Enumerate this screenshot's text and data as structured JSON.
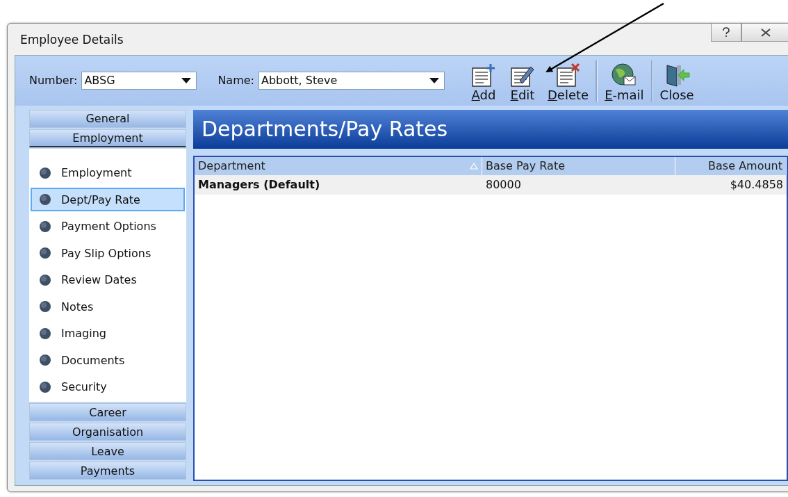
{
  "window": {
    "title": "Employee Details"
  },
  "filters": [
    {
      "label": "Number:",
      "value": "ABSG"
    },
    {
      "label": "Name:",
      "value": "Abbott, Steve"
    }
  ],
  "toolbar": [
    {
      "kind": "add",
      "label": "Add",
      "mnemonic_underlined": true
    },
    {
      "kind": "edit",
      "label": "Edit",
      "mnemonic_underlined": true
    },
    {
      "kind": "delete",
      "label": "Delete",
      "mnemonic_underlined": true
    },
    {
      "kind": "email",
      "label": "E-mail",
      "mnemonic_underlined": true
    },
    {
      "kind": "close",
      "label": "Close",
      "mnemonic_underlined": false
    }
  ],
  "sidebar": {
    "top_sections": [
      {
        "label": "General",
        "selected": false
      },
      {
        "label": "Employment",
        "selected": true
      }
    ],
    "items": [
      {
        "label": "Employment",
        "selected": false
      },
      {
        "label": "Dept/Pay Rate",
        "selected": true
      },
      {
        "label": "Payment Options",
        "selected": false
      },
      {
        "label": "Pay Slip Options",
        "selected": false
      },
      {
        "label": "Review Dates",
        "selected": false
      },
      {
        "label": "Notes",
        "selected": false
      },
      {
        "label": "Imaging",
        "selected": false
      },
      {
        "label": "Documents",
        "selected": false
      },
      {
        "label": "Security",
        "selected": false
      }
    ],
    "bottom_sections": [
      {
        "label": "Career",
        "selected": false
      },
      {
        "label": "Organisation",
        "selected": false
      },
      {
        "label": "Leave",
        "selected": false
      },
      {
        "label": "Payments",
        "selected": false
      }
    ]
  },
  "panel": {
    "title": "Departments/Pay Rates"
  },
  "table": {
    "columns": [
      {
        "label": "Department",
        "sorted": true
      },
      {
        "label": "Base Pay Rate",
        "sorted": false
      },
      {
        "label": "Base Amount",
        "sorted": false
      }
    ],
    "rows": [
      {
        "cells": [
          "Managers (Default)",
          "80000",
          "$40.4858"
        ],
        "default": true
      }
    ]
  }
}
